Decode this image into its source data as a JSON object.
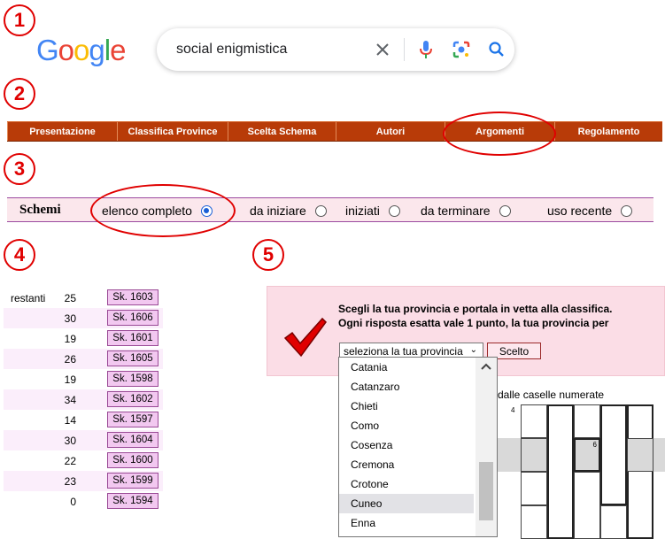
{
  "steps": [
    "1",
    "2",
    "3",
    "4",
    "5"
  ],
  "google": {
    "logo_letters": [
      "G",
      "o",
      "o",
      "g",
      "l",
      "e"
    ],
    "logo_colors": [
      "#4285F4",
      "#EA4335",
      "#FBBC05",
      "#4285F4",
      "#34A853",
      "#EA4335"
    ],
    "query": "social enigmistica",
    "icons": [
      "close-icon",
      "mic-icon",
      "lens-icon",
      "search-icon"
    ]
  },
  "menu": {
    "items": [
      "Presentazione",
      "Classifica Province",
      "Scelta Schema",
      "Autori",
      "Argomenti",
      "Regolamento"
    ],
    "color": "#b83b08"
  },
  "schemi": {
    "label": "Schemi",
    "options": [
      {
        "label": "elenco completo",
        "selected": true
      },
      {
        "label": "da iniziare",
        "selected": false
      },
      {
        "label": "iniziati",
        "selected": false
      },
      {
        "label": "da terminare",
        "selected": false
      },
      {
        "label": "uso recente",
        "selected": false
      }
    ]
  },
  "schemes_list": {
    "first_label": "restanti",
    "rows": [
      {
        "count": "25",
        "button": "Sk. 1603"
      },
      {
        "count": "30",
        "button": "Sk. 1606"
      },
      {
        "count": "19",
        "button": "Sk. 1601"
      },
      {
        "count": "26",
        "button": "Sk. 1605"
      },
      {
        "count": "19",
        "button": "Sk. 1598"
      },
      {
        "count": "34",
        "button": "Sk. 1602"
      },
      {
        "count": "14",
        "button": "Sk. 1597"
      },
      {
        "count": "30",
        "button": "Sk. 1604"
      },
      {
        "count": "22",
        "button": "Sk. 1600"
      },
      {
        "count": "23",
        "button": "Sk. 1599"
      },
      {
        "count": "0",
        "button": "Sk. 1594"
      }
    ]
  },
  "province_panel": {
    "line1": "Scegli la tua provincia e portala in vetta alla classifica.",
    "line2": "Ogni risposta esatta vale 1 punto, la tua provincia per",
    "select_value": "seleziona la tua provincia",
    "button": "Scelto",
    "dropdown_items": [
      "Catania",
      "Catanzaro",
      "Chieti",
      "Como",
      "Cosenza",
      "Cremona",
      "Crotone",
      "Cuneo",
      "Enna"
    ],
    "highlighted": "Cuneo"
  },
  "grid": {
    "caption": "dalle caselle numerate",
    "numbers": [
      "4",
      "6"
    ]
  }
}
